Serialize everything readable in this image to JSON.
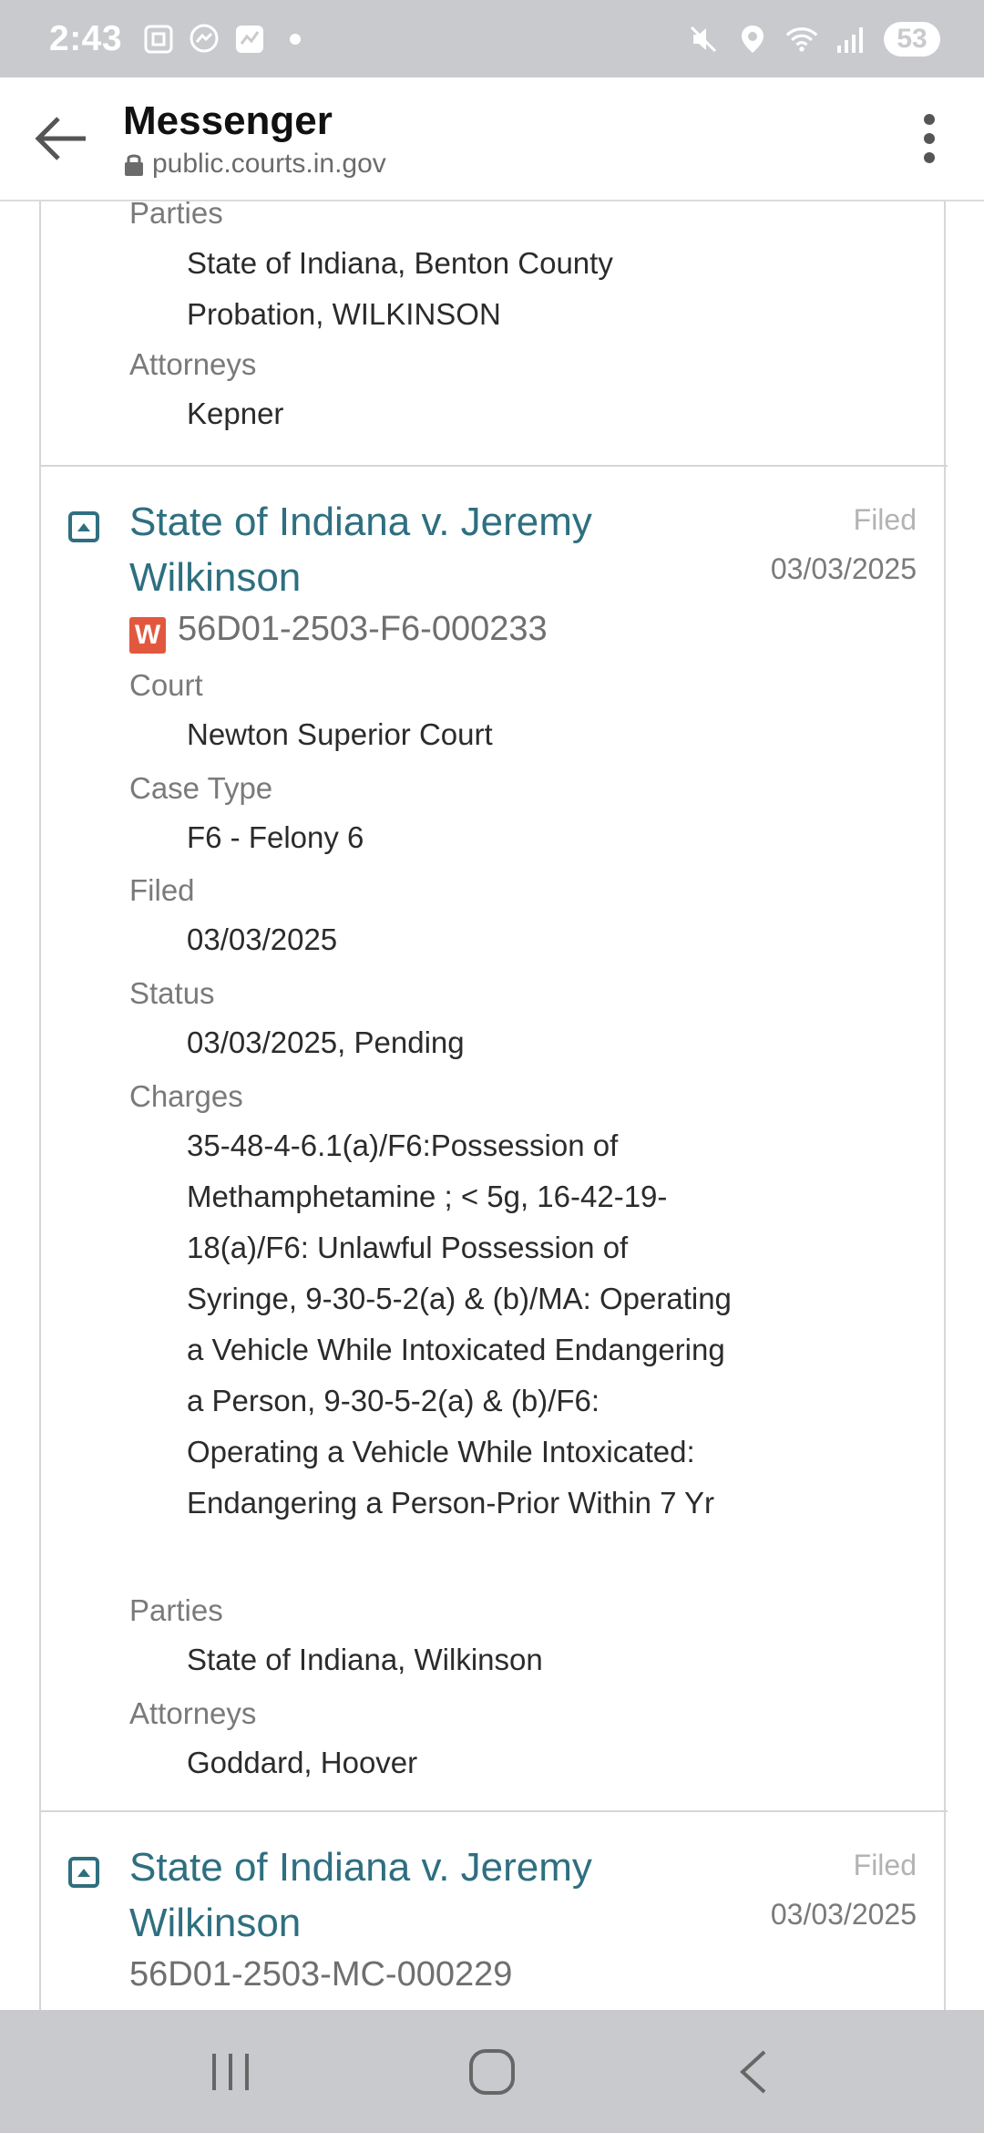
{
  "status_bar": {
    "time": "2:43",
    "left_icons": [
      "screenshot-icon",
      "messenger-icon",
      "chart-app-icon",
      "dot-icon"
    ],
    "right_icons": [
      "mute-icon",
      "location-icon",
      "wifi-icon",
      "signal-icon"
    ],
    "battery": "53"
  },
  "app_bar": {
    "title": "Messenger",
    "url": "public.courts.in.gov"
  },
  "case_prev": {
    "parties_label": "Parties",
    "parties_value": "State of Indiana, Benton County Probation, WILKINSON",
    "attorneys_label": "Attorneys",
    "attorneys_value": "Kepner"
  },
  "case_1": {
    "title": "State of Indiana v. Jeremy Wilkinson",
    "case_number": "56D01-2503-F6-000233",
    "badge": "W",
    "filed_label": "Filed",
    "filed_date": "03/03/2025",
    "court_label": "Court",
    "court_value": "Newton Superior Court",
    "case_type_label": "Case Type",
    "case_type_value": "F6 - Felony 6",
    "filed_field_label": "Filed",
    "filed_field_value": "03/03/2025",
    "status_label": "Status",
    "status_value": "03/03/2025, Pending",
    "charges_label": "Charges",
    "charges_value": "35-48-4-6.1(a)/F6:Possession of Methamphetamine ; < 5g, 16-42-19-18(a)/F6: Unlawful Possession of Syringe, 9-30-5-2(a) & (b)/MA: Operating a Vehicle While Intoxicated Endangering a Person, 9-30-5-2(a) & (b)/F6: Operating a Vehicle While Intoxicated: Endangering a Person-Prior Within 7 Yr",
    "parties_label": "Parties",
    "parties_value": "State of Indiana, Wilkinson",
    "attorneys_label": "Attorneys",
    "attorneys_value": "Goddard, Hoover"
  },
  "case_2": {
    "title": "State of Indiana v. Jeremy Wilkinson",
    "case_number": "56D01-2503-MC-000229",
    "filed_label": "Filed",
    "filed_date": "03/03/2025"
  },
  "nav_bar": {
    "buttons": [
      "recent-apps-icon",
      "home-icon",
      "back-icon"
    ]
  }
}
